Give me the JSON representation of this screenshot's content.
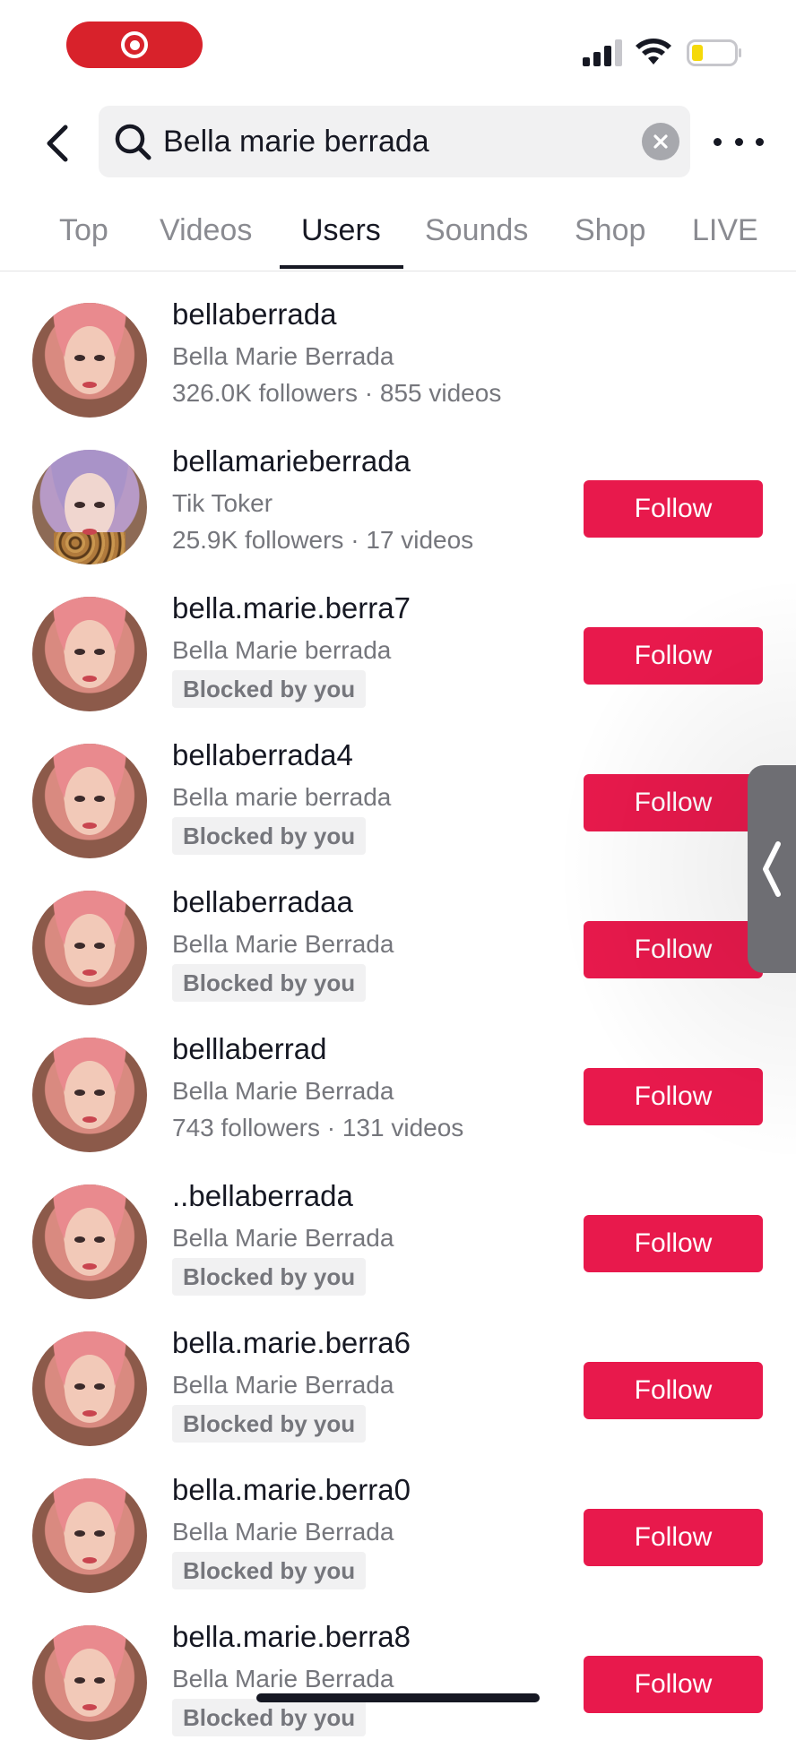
{
  "status_bar": {
    "recording_icon": "screen-record-icon",
    "signal_icon": "cellular-signal-icon",
    "wifi_icon": "wifi-icon",
    "battery_icon": "battery-low-icon",
    "battery_color": "#f5d90a"
  },
  "search": {
    "query": "Bella marie berrada",
    "back_icon": "chevron-left-icon",
    "search_icon": "search-icon",
    "clear_icon": "clear-icon",
    "more_icon": "more-icon"
  },
  "tabs": [
    {
      "label": "Top",
      "active": false
    },
    {
      "label": "Videos",
      "active": false
    },
    {
      "label": "Users",
      "active": true
    },
    {
      "label": "Sounds",
      "active": false
    },
    {
      "label": "Shop",
      "active": false
    },
    {
      "label": "LIVE",
      "active": false
    }
  ],
  "users": [
    {
      "username": "bellaberrada",
      "name": "Bella Marie Berrada",
      "stats": "326.0K followers · 855 videos",
      "blocked": false,
      "follow": null
    },
    {
      "username": "bellamarieberrada",
      "name": "Tik Toker",
      "stats": "25.9K followers · 17 videos",
      "blocked": false,
      "follow": "Follow"
    },
    {
      "username": "bella.marie.berra7",
      "name": "Bella Marie berrada",
      "blocked": true,
      "blocked_label": "Blocked by you",
      "follow": "Follow"
    },
    {
      "username": "bellaberrada4",
      "name": "Bella marie berrada",
      "blocked": true,
      "blocked_label": "Blocked by you",
      "follow": "Follow"
    },
    {
      "username": "bellaberradaa",
      "name": "Bella Marie Berrada",
      "blocked": true,
      "blocked_label": "Blocked by you",
      "follow": "Follow"
    },
    {
      "username": "belllaberrad",
      "name": "Bella Marie Berrada",
      "stats": "743 followers · 131 videos",
      "blocked": false,
      "follow": "Follow"
    },
    {
      "username": "..bellaberrada",
      "name": "Bella Marie Berrada",
      "blocked": true,
      "blocked_label": "Blocked by you",
      "follow": "Follow"
    },
    {
      "username": "bella.marie.berra6",
      "name": "Bella Marie Berrada",
      "blocked": true,
      "blocked_label": "Blocked by you",
      "follow": "Follow"
    },
    {
      "username": "bella.marie.berra0",
      "name": "Bella Marie Berrada",
      "blocked": true,
      "blocked_label": "Blocked by you",
      "follow": "Follow"
    },
    {
      "username": "bella.marie.berra8",
      "name": "Bella Marie Berrada",
      "blocked": true,
      "blocked_label": "Blocked by you",
      "follow": "Follow"
    }
  ],
  "side_handle": {
    "icon": "chevron-left-icon"
  },
  "colors": {
    "accent": "#e8194c",
    "record": "#d8222b",
    "text": "#161823",
    "muted": "#75767c"
  }
}
